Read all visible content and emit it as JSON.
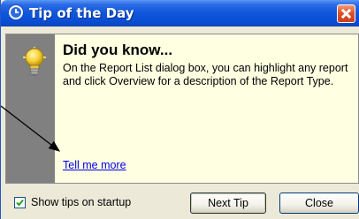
{
  "window": {
    "title": "Tip of the Day"
  },
  "tip": {
    "heading": "Did you know...",
    "body": "On the Report List dialog box, you can highlight any report and click Overview for a description of the Report Type.",
    "link_label": "Tell me more"
  },
  "footer": {
    "show_tips_label": "Show tips on startup",
    "show_tips_checked": true,
    "next_tip_label": "Next Tip",
    "close_label": "Close"
  },
  "icons": {
    "title": "clock-icon",
    "close": "close-icon",
    "tip": "lightbulb-icon",
    "checkbox": "checkmark-icon"
  },
  "colors": {
    "titlebar": "#0a4ed6",
    "panel_background": "#ffffe1",
    "side_stripe": "#808080",
    "dialog_face": "#ece9d8",
    "link": "#0000ee",
    "close_button": "#e0512a"
  }
}
